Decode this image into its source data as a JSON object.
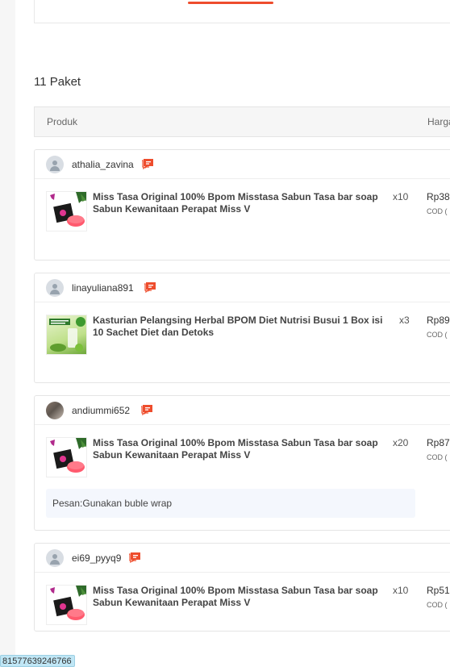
{
  "package_count": "11 Paket",
  "table": {
    "product_header": "Produk",
    "price_header": "Harga"
  },
  "orders": [
    {
      "username": "athalia_zavina",
      "avatar": "default-avatar-icon",
      "item": {
        "name": "Miss Tasa Original 100% Bpom Misstasa Sabun Tasa bar soap Sabun Kewanitaan Perapat Miss V",
        "quantity": "x10",
        "price": "Rp38",
        "payment": "COD ("
      }
    },
    {
      "username": "linayuliana891",
      "avatar": "default-avatar-icon",
      "item": {
        "name": "Kasturian Pelangsing Herbal BPOM Diet Nutrisi Busui 1 Box isi 10 Sachet Diet dan Detoks",
        "quantity": "x3",
        "price": "Rp89",
        "payment": "COD ("
      }
    },
    {
      "username": "andiummi652",
      "avatar": "photo-avatar",
      "item": {
        "name": "Miss Tasa Original 100% Bpom Misstasa Sabun Tasa bar soap Sabun Kewanitaan Perapat Miss V",
        "quantity": "x20",
        "price": "Rp87",
        "payment": "COD ("
      },
      "note": "Pesan:Gunakan buble wrap"
    },
    {
      "username": "ei69_pyyq9",
      "avatar": "default-avatar-icon",
      "item": {
        "name": "Miss Tasa Original 100% Bpom Misstasa Sabun Tasa bar soap Sabun Kewanitaan Perapat Miss V",
        "quantity": "x10",
        "price": "Rp51",
        "payment": "COD ("
      }
    }
  ],
  "tooltip_text": "81577639246766",
  "colors": {
    "accent": "#ee4d2d",
    "note_background": "#f4f7fd",
    "tooltip_background": "#bfe6f5"
  }
}
